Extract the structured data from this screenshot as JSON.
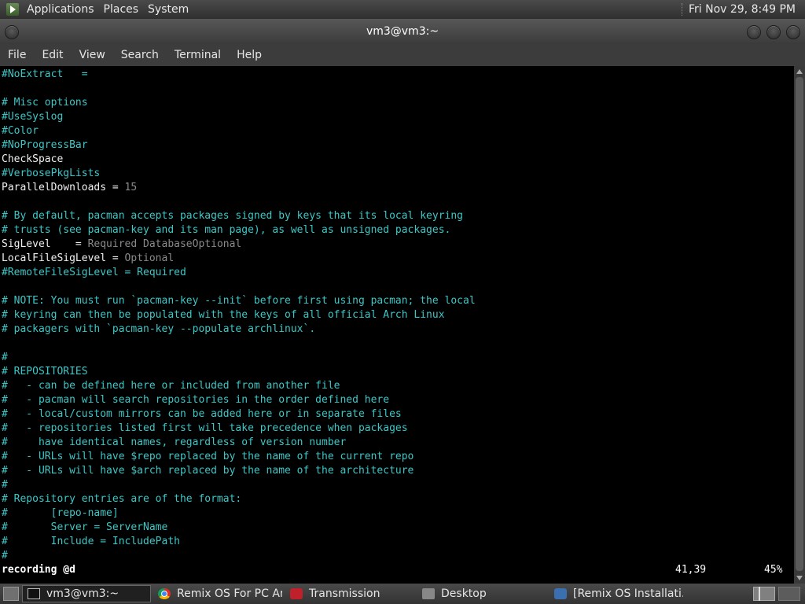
{
  "top_panel": {
    "applications": "Applications",
    "places": "Places",
    "system": "System",
    "clock": "Fri Nov 29,  8:49 PM"
  },
  "window": {
    "title": "vm3@vm3:~"
  },
  "menubar": [
    "File",
    "Edit",
    "View",
    "Search",
    "Terminal",
    "Help"
  ],
  "terminal": {
    "lines": [
      {
        "segments": [
          {
            "text": "#NoExtract   =",
            "style": "comment"
          }
        ]
      },
      {
        "segments": []
      },
      {
        "segments": [
          {
            "text": "# Misc options",
            "style": "comment"
          }
        ]
      },
      {
        "segments": [
          {
            "text": "#UseSyslog",
            "style": "comment"
          }
        ]
      },
      {
        "segments": [
          {
            "text": "#Color",
            "style": "comment"
          }
        ]
      },
      {
        "segments": [
          {
            "text": "#NoProgressBar",
            "style": "comment"
          }
        ]
      },
      {
        "segments": [
          {
            "text": "CheckSpace",
            "style": "default"
          }
        ]
      },
      {
        "segments": [
          {
            "text": "#VerbosePkgLists",
            "style": "comment"
          }
        ]
      },
      {
        "segments": [
          {
            "text": "ParallelDownloads = ",
            "style": "default"
          },
          {
            "text": "15",
            "style": "value"
          }
        ]
      },
      {
        "segments": []
      },
      {
        "segments": [
          {
            "text": "# By default, pacman accepts packages signed by keys that its local keyring",
            "style": "comment"
          }
        ]
      },
      {
        "segments": [
          {
            "text": "# trusts (see pacman-key and its man page), as well as unsigned packages.",
            "style": "comment"
          }
        ]
      },
      {
        "segments": [
          {
            "text": "SigLevel    = ",
            "style": "default"
          },
          {
            "text": "Required DatabaseOptional",
            "style": "value"
          }
        ]
      },
      {
        "segments": [
          {
            "text": "LocalFileSigLevel = ",
            "style": "default"
          },
          {
            "text": "Optional",
            "style": "value"
          }
        ]
      },
      {
        "segments": [
          {
            "text": "#RemoteFileSigLevel = Required",
            "style": "comment"
          }
        ]
      },
      {
        "segments": []
      },
      {
        "segments": [
          {
            "text": "# NOTE: You must run `pacman-key --init` before first using pacman; the local",
            "style": "comment"
          }
        ]
      },
      {
        "segments": [
          {
            "text": "# keyring can then be populated with the keys of all official Arch Linux",
            "style": "comment"
          }
        ]
      },
      {
        "segments": [
          {
            "text": "# packagers with `pacman-key --populate archlinux`.",
            "style": "comment"
          }
        ]
      },
      {
        "segments": []
      },
      {
        "segments": [
          {
            "text": "#",
            "style": "comment"
          }
        ]
      },
      {
        "segments": [
          {
            "text": "# REPOSITORIES",
            "style": "comment"
          }
        ]
      },
      {
        "segments": [
          {
            "text": "#   - can be defined here or included from another file",
            "style": "comment"
          }
        ]
      },
      {
        "segments": [
          {
            "text": "#   - pacman will search repositories in the order defined here",
            "style": "comment"
          }
        ]
      },
      {
        "segments": [
          {
            "text": "#   - local/custom mirrors can be added here or in separate files",
            "style": "comment"
          }
        ]
      },
      {
        "segments": [
          {
            "text": "#   - repositories listed first will take precedence when packages",
            "style": "comment"
          }
        ]
      },
      {
        "segments": [
          {
            "text": "#     have identical names, regardless of version number",
            "style": "comment"
          }
        ]
      },
      {
        "segments": [
          {
            "text": "#   - URLs will have $repo replaced by the name of the current repo",
            "style": "comment"
          }
        ]
      },
      {
        "segments": [
          {
            "text": "#   - URLs will have $arch replaced by the name of the architecture",
            "style": "comment"
          }
        ]
      },
      {
        "segments": [
          {
            "text": "#",
            "style": "comment"
          }
        ]
      },
      {
        "segments": [
          {
            "text": "# Repository entries are of the format:",
            "style": "comment"
          }
        ]
      },
      {
        "segments": [
          {
            "text": "#       [repo-name]",
            "style": "comment"
          }
        ]
      },
      {
        "segments": [
          {
            "text": "#       Server = ServerName",
            "style": "comment"
          }
        ]
      },
      {
        "segments": [
          {
            "text": "#       Include = IncludePath",
            "style": "comment"
          }
        ]
      },
      {
        "segments": [
          {
            "text": "#",
            "style": "comment"
          }
        ]
      }
    ],
    "status": {
      "mode": "recording @d",
      "position": "41,39",
      "percent": "45%"
    }
  },
  "taskbar": {
    "tasks": [
      {
        "label": "vm3@vm3:~",
        "icon": "terminal-icon",
        "active": true
      },
      {
        "label": "Remix OS For PC An...",
        "icon": "chrome-icon",
        "active": false
      },
      {
        "label": "Transmission",
        "icon": "transmission-icon",
        "active": false
      },
      {
        "label": "Desktop",
        "icon": "folder-icon",
        "active": false
      },
      {
        "label": "[Remix OS Installati...",
        "icon": "remix-icon",
        "active": false
      }
    ]
  },
  "colors": {
    "comment": "#3ec6c6",
    "default": "#f0f0f0",
    "value": "#8a8a8a",
    "terminal_bg": "#000000",
    "panel_bg": "#3c3c3c"
  }
}
